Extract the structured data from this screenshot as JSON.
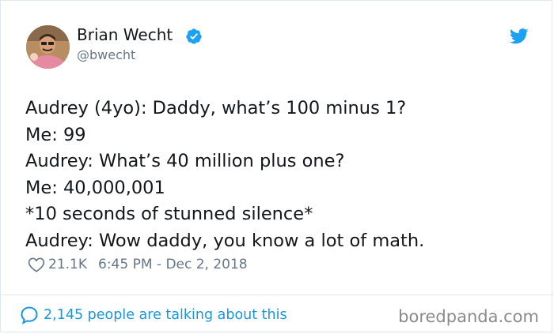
{
  "author": {
    "name": "Brian Wecht",
    "handle": "@bwecht",
    "verified": true,
    "avatar_icon": "avatar-photo"
  },
  "tweet": {
    "lines": [
      "Audrey (4yo): Daddy, what’s 100 minus 1?",
      "Me: 99",
      "Audrey: What’s 40 million plus one?",
      "Me: 40,000,001",
      "*10 seconds of stunned silence*",
      "Audrey: Wow daddy, you know a lot of math."
    ],
    "likes": "21.1K",
    "timestamp": "6:45 PM - Dec 2, 2018"
  },
  "footer": {
    "talking_text": "2,145 people are talking about this",
    "watermark": "boredpanda.com"
  },
  "colors": {
    "twitter_blue": "#1da1f2",
    "link_blue": "#1b95e0",
    "muted": "#657786",
    "border": "#e1e8ed"
  },
  "icons": [
    "verified-badge-icon",
    "twitter-bird-icon",
    "heart-icon",
    "comment-bubble-icon"
  ]
}
